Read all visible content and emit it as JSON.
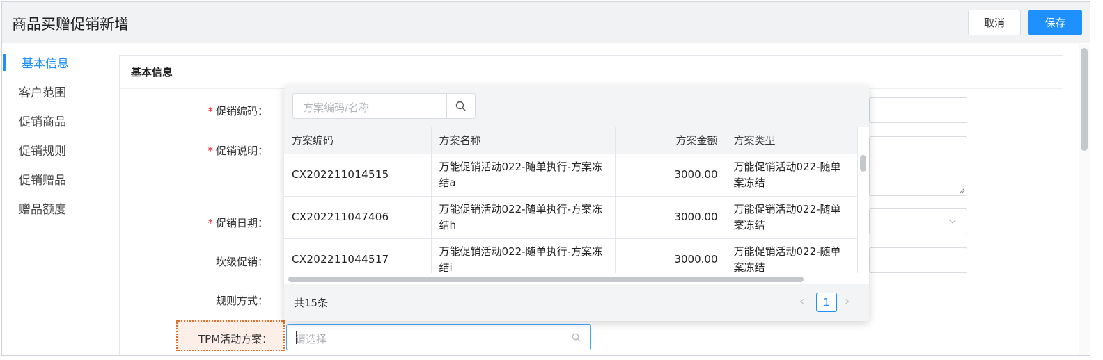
{
  "header": {
    "title": "商品买赠促销新增",
    "cancel_label": "取消",
    "save_label": "保存"
  },
  "sidebar": {
    "items": [
      {
        "label": "基本信息",
        "active": true
      },
      {
        "label": "客户范围",
        "active": false
      },
      {
        "label": "促销商品",
        "active": false
      },
      {
        "label": "促销规则",
        "active": false
      },
      {
        "label": "促销赠品",
        "active": false
      },
      {
        "label": "赠品额度",
        "active": false
      }
    ]
  },
  "card": {
    "title": "基本信息"
  },
  "form": {
    "required_mark": "*",
    "promo_code_label": "促销编码：",
    "promo_desc_label": "促销说明：",
    "promo_date_label": "促销日期：",
    "tier_promo_label": "坎级促销：",
    "rule_mode_label": "规则方式：",
    "tpm_label": "TPM活动方案：",
    "tpm_placeholder": "请选择"
  },
  "dropdown": {
    "search_placeholder": "方案编码/名称",
    "columns": [
      "方案编码",
      "方案名称",
      "方案金额",
      "方案类型"
    ],
    "rows": [
      {
        "code": "CX202211014515",
        "name": "万能促销活动022-随单执行-方案冻结a",
        "amount": "3000.00",
        "type": "万能促销活动022-随单案冻结"
      },
      {
        "code": "CX202211047406",
        "name": "万能促销活动022-随单执行-方案冻结h",
        "amount": "3000.00",
        "type": "万能促销活动022-随单案冻结"
      },
      {
        "code": "CX202211044517",
        "name": "万能促销活动022-随单执行-方案冻结i",
        "amount": "3000.00",
        "type": "万能促销活动022-随单案冻结"
      }
    ],
    "total_label": "共15条",
    "current_page": "1"
  },
  "colors": {
    "primary": "#1e90ff",
    "required": "#f5222d",
    "highlight_border": "#e0702a"
  }
}
